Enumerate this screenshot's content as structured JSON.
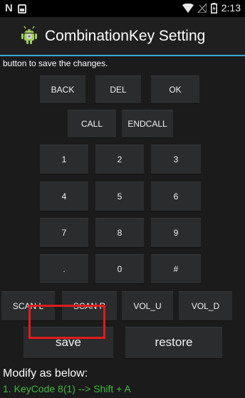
{
  "status_bar": {
    "time": "2:13",
    "icons": [
      "n-notification-icon",
      "image-notification-icon",
      "wifi-icon",
      "no-signal-icon",
      "battery-icon"
    ]
  },
  "action_bar": {
    "title": "CombinationKey Setting",
    "app_icon": "android-icon"
  },
  "info_text": "button to save the changes.",
  "keys": {
    "row1": [
      "BACK",
      "DEL",
      "OK"
    ],
    "row2": [
      "CALL",
      "ENDCALL"
    ],
    "numpad": [
      "1",
      "2",
      "3",
      "4",
      "5",
      "6",
      "7",
      "8",
      "9",
      ".",
      "0",
      "#"
    ],
    "row_scan": [
      "SCAN L",
      "SCAN R",
      "VOL_U",
      "VOL_D"
    ]
  },
  "actions": {
    "save": "save",
    "restore": "restore"
  },
  "modify_label": "Modify as below:",
  "mappings": [
    "1. KeyCode 8(1) --> Shift + A"
  ],
  "colors": {
    "accent_line": "#3aa9d6",
    "highlight": "#e21b1b",
    "mapping_text": "#3db83d"
  }
}
